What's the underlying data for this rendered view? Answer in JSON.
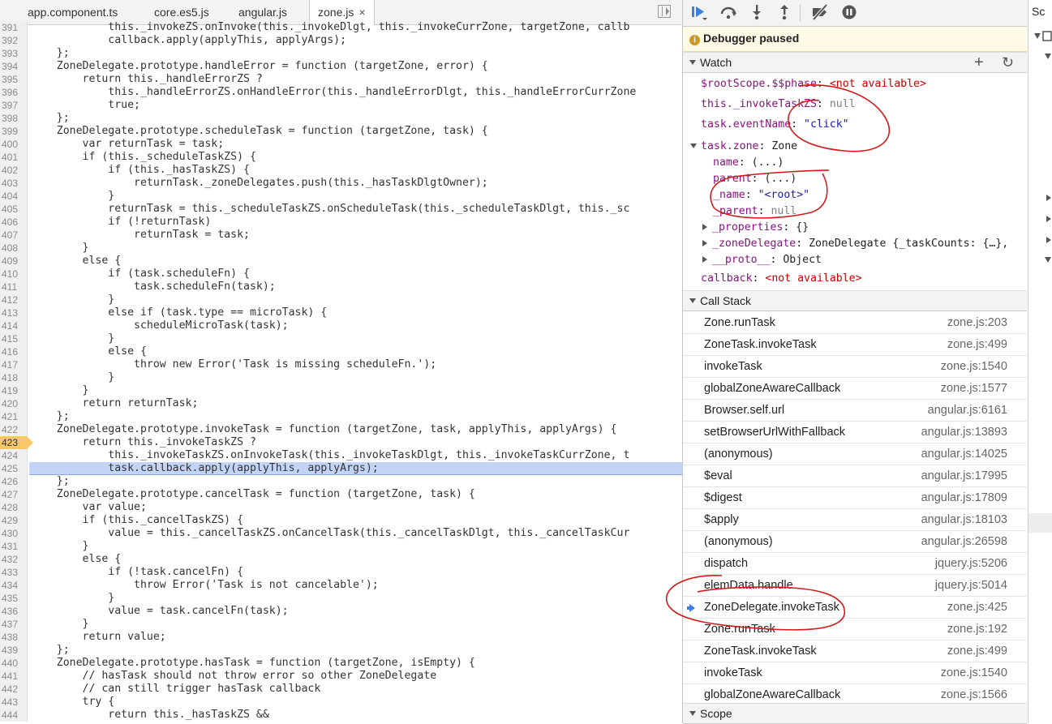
{
  "tabs": [
    {
      "label": "app.component.ts",
      "active": false
    },
    {
      "label": "core.es5.js",
      "active": false
    },
    {
      "label": "angular.js",
      "active": false
    },
    {
      "label": "zone.js",
      "active": true
    }
  ],
  "tab_close_glyph": "×",
  "code_lines": [
    {
      "n": "391",
      "t": "            this._invokeZS.onInvoke(this._invokeDlgt, this._invokeCurrZone, targetZone, callb"
    },
    {
      "n": "392",
      "t": "            callback.apply(applyThis, applyArgs);"
    },
    {
      "n": "393",
      "t": "    };"
    },
    {
      "n": "394",
      "t": "    ZoneDelegate.prototype.handleError = function (targetZone, error) {"
    },
    {
      "n": "395",
      "t": "        return this._handleErrorZS ?"
    },
    {
      "n": "396",
      "t": "            this._handleErrorZS.onHandleError(this._handleErrorDlgt, this._handleErrorCurrZone"
    },
    {
      "n": "397",
      "t": "            true;"
    },
    {
      "n": "398",
      "t": "    };"
    },
    {
      "n": "399",
      "t": "    ZoneDelegate.prototype.scheduleTask = function (targetZone, task) {"
    },
    {
      "n": "400",
      "t": "        var returnTask = task;"
    },
    {
      "n": "401",
      "t": "        if (this._scheduleTaskZS) {"
    },
    {
      "n": "402",
      "t": "            if (this._hasTaskZS) {"
    },
    {
      "n": "403",
      "t": "                returnTask._zoneDelegates.push(this._hasTaskDlgtOwner);"
    },
    {
      "n": "404",
      "t": "            }"
    },
    {
      "n": "405",
      "t": "            returnTask = this._scheduleTaskZS.onScheduleTask(this._scheduleTaskDlgt, this._sc"
    },
    {
      "n": "406",
      "t": "            if (!returnTask)"
    },
    {
      "n": "407",
      "t": "                returnTask = task;"
    },
    {
      "n": "408",
      "t": "        }"
    },
    {
      "n": "409",
      "t": "        else {"
    },
    {
      "n": "410",
      "t": "            if (task.scheduleFn) {"
    },
    {
      "n": "411",
      "t": "                task.scheduleFn(task);"
    },
    {
      "n": "412",
      "t": "            }"
    },
    {
      "n": "413",
      "t": "            else if (task.type == microTask) {"
    },
    {
      "n": "414",
      "t": "                scheduleMicroTask(task);"
    },
    {
      "n": "415",
      "t": "            }"
    },
    {
      "n": "416",
      "t": "            else {"
    },
    {
      "n": "417",
      "t": "                throw new Error('Task is missing scheduleFn.');"
    },
    {
      "n": "418",
      "t": "            }"
    },
    {
      "n": "419",
      "t": "        }"
    },
    {
      "n": "420",
      "t": "        return returnTask;"
    },
    {
      "n": "421",
      "t": "    };"
    },
    {
      "n": "422",
      "t": "    ZoneDelegate.prototype.invokeTask = function (targetZone, task, applyThis, applyArgs) {"
    },
    {
      "n": "423",
      "t": "        return this._invokeTaskZS ?",
      "bp": true
    },
    {
      "n": "424",
      "t": "            this._invokeTaskZS.onInvokeTask(this._invokeTaskDlgt, this._invokeTaskCurrZone, t"
    },
    {
      "n": "425",
      "t": "            task.callback.apply(applyThis, applyArgs);",
      "cur": true
    },
    {
      "n": "426",
      "t": "    };"
    },
    {
      "n": "427",
      "t": "    ZoneDelegate.prototype.cancelTask = function (targetZone, task) {"
    },
    {
      "n": "428",
      "t": "        var value;"
    },
    {
      "n": "429",
      "t": "        if (this._cancelTaskZS) {"
    },
    {
      "n": "430",
      "t": "            value = this._cancelTaskZS.onCancelTask(this._cancelTaskDlgt, this._cancelTaskCur"
    },
    {
      "n": "431",
      "t": "        }"
    },
    {
      "n": "432",
      "t": "        else {"
    },
    {
      "n": "433",
      "t": "            if (!task.cancelFn) {"
    },
    {
      "n": "434",
      "t": "                throw Error('Task is not cancelable');"
    },
    {
      "n": "435",
      "t": "            }"
    },
    {
      "n": "436",
      "t": "            value = task.cancelFn(task);"
    },
    {
      "n": "437",
      "t": "        }"
    },
    {
      "n": "438",
      "t": "        return value;"
    },
    {
      "n": "439",
      "t": "    };"
    },
    {
      "n": "440",
      "t": "    ZoneDelegate.prototype.hasTask = function (targetZone, isEmpty) {"
    },
    {
      "n": "441",
      "t": "        // hasTask should not throw error so other ZoneDelegate"
    },
    {
      "n": "442",
      "t": "        // can still trigger hasTask callback"
    },
    {
      "n": "443",
      "t": "        try {"
    },
    {
      "n": "444",
      "t": "            return this._hasTaskZS &&"
    }
  ],
  "debugger": {
    "paused_icon": "i",
    "paused_label": "Debugger paused",
    "watch_label": "Watch",
    "add_glyph": "+",
    "refresh_glyph": "↻",
    "call_stack_label": "Call Stack",
    "scope_label": "Scope"
  },
  "watch": {
    "rootscope_key": "$rootScope.$$phase",
    "rootscope_val": "<not available>",
    "invoke_key": "this._invokeTaskZS",
    "invoke_val": "null",
    "event_key": "task.eventName",
    "event_val": "\"click\"",
    "zone_key": "task.zone",
    "zone_val": "Zone",
    "name_key": "name",
    "name_val": "(...)",
    "parent_key": "parent",
    "parent_val": "(...)",
    "uname_key": "_name",
    "uname_val": "\"<root>\"",
    "uparent_key": "_parent",
    "uparent_val": "null",
    "props_key": "_properties",
    "props_val": "{}",
    "zd_key": "_zoneDelegate",
    "zd_val": "ZoneDelegate {_taskCounts: {…},",
    "proto_key": "__proto__",
    "proto_val": "Object",
    "callback_key": "callback",
    "callback_val": "<not available>",
    "sep": ": "
  },
  "call_stack": [
    {
      "fn": "Zone.runTask",
      "loc": "zone.js:203"
    },
    {
      "fn": "ZoneTask.invokeTask",
      "loc": "zone.js:499"
    },
    {
      "fn": "invokeTask",
      "loc": "zone.js:1540"
    },
    {
      "fn": "globalZoneAwareCallback",
      "loc": "zone.js:1577"
    },
    {
      "fn": "Browser.self.url",
      "loc": "angular.js:6161"
    },
    {
      "fn": "setBrowserUrlWithFallback",
      "loc": "angular.js:13893"
    },
    {
      "fn": "(anonymous)",
      "loc": "angular.js:14025"
    },
    {
      "fn": "$eval",
      "loc": "angular.js:17995"
    },
    {
      "fn": "$digest",
      "loc": "angular.js:17809"
    },
    {
      "fn": "$apply",
      "loc": "angular.js:18103"
    },
    {
      "fn": "(anonymous)",
      "loc": "angular.js:26598"
    },
    {
      "fn": "dispatch",
      "loc": "jquery.js:5206"
    },
    {
      "fn": "elemData.handle",
      "loc": "jquery.js:5014"
    },
    {
      "fn": "ZoneDelegate.invokeTask",
      "loc": "zone.js:425",
      "current": true
    },
    {
      "fn": "Zone.runTask",
      "loc": "zone.js:192"
    },
    {
      "fn": "ZoneTask.invokeTask",
      "loc": "zone.js:499"
    },
    {
      "fn": "invokeTask",
      "loc": "zone.js:1540"
    },
    {
      "fn": "globalZoneAwareCallback",
      "loc": "zone.js:1566"
    }
  ],
  "right_sliver": {
    "label": "Sc"
  },
  "colors": {
    "annotation": "#d11a1a",
    "current_frame": "#3b7fe0",
    "breakpoint": "#f7c768",
    "highlight": "#c4d4f7"
  }
}
